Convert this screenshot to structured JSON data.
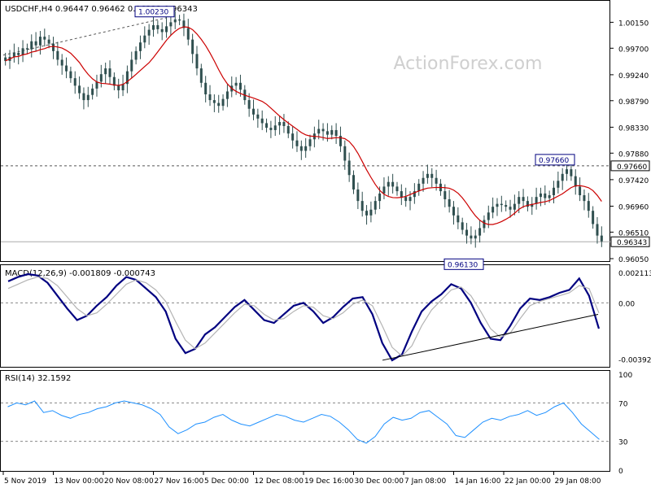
{
  "header": {
    "symbol_info": "USDCHF,H4  0.96447 0.96462 0.96322 0.96343",
    "watermark": "ActionForex.com"
  },
  "colors": {
    "candle": "#2f4f4f",
    "ma": "#cc0000",
    "macd_line": "#000080",
    "macd_signal": "#b4b4b4",
    "rsi": "#1e90ff",
    "level_line": "#555555",
    "frame": "#000000"
  },
  "chart_data": [
    {
      "type": "candlestick",
      "title": "USDCHF,H4  0.96447 0.96462 0.96322 0.96343",
      "ylim": [
        0.9605,
        1.0048
      ],
      "y_ticks": [
        "1.00150",
        "0.99700",
        "0.99240",
        "0.98790",
        "0.98330",
        "0.97880",
        "0.97420",
        "0.96960",
        "0.96510",
        "0.96050"
      ],
      "current_price": "0.96343",
      "levels": [
        {
          "label": "0.97660",
          "value": 0.9766,
          "style": "dashed"
        }
      ],
      "annotations": [
        {
          "label": "1.00230",
          "value": 1.0023
        },
        {
          "label": "0.97660",
          "value": 0.9766
        },
        {
          "label": "0.96130",
          "value": 0.9613
        }
      ],
      "moving_average": "red line",
      "close_series": [
        0.9948,
        0.9955,
        0.9962,
        0.9958,
        0.997,
        0.9968,
        0.9982,
        0.9975,
        0.999,
        0.9985,
        0.9978,
        0.9965,
        0.995,
        0.994,
        0.993,
        0.9918,
        0.9905,
        0.9892,
        0.988,
        0.9889,
        0.99,
        0.9912,
        0.9925,
        0.9935,
        0.992,
        0.9905,
        0.9897,
        0.9908,
        0.993,
        0.995,
        0.9965,
        0.998,
        0.9992,
        1.0002,
        1.001,
        1.0003,
        0.9998,
        1.0008,
        1.0015,
        1.002,
        1.0018,
        1.0005,
        0.9985,
        0.996,
        0.9935,
        0.991,
        0.989,
        0.988,
        0.9875,
        0.987,
        0.9882,
        0.9895,
        0.9905,
        0.991,
        0.9898,
        0.988,
        0.9865,
        0.9855,
        0.9848,
        0.984,
        0.9832,
        0.9828,
        0.9836,
        0.9842,
        0.9835,
        0.9822,
        0.981,
        0.98,
        0.9792,
        0.98,
        0.9812,
        0.9822,
        0.983,
        0.9826,
        0.982,
        0.9828,
        0.9818,
        0.98,
        0.9775,
        0.975,
        0.9725,
        0.9705,
        0.9688,
        0.968,
        0.969,
        0.9705,
        0.9718,
        0.973,
        0.9738,
        0.973,
        0.9722,
        0.9712,
        0.9705,
        0.9712,
        0.9722,
        0.9735,
        0.9745,
        0.9752,
        0.9745,
        0.9735,
        0.9722,
        0.9708,
        0.9695,
        0.968,
        0.9668,
        0.9655,
        0.9645,
        0.964,
        0.9645,
        0.9658,
        0.9672,
        0.9685,
        0.9695,
        0.97,
        0.9698,
        0.9695,
        0.969,
        0.97,
        0.9712,
        0.9705,
        0.9695,
        0.97,
        0.9712,
        0.9718,
        0.971,
        0.9715,
        0.9728,
        0.974,
        0.9752,
        0.976,
        0.9748,
        0.973,
        0.9715,
        0.9705,
        0.9688,
        0.9665,
        0.9645,
        0.9635
      ]
    },
    {
      "type": "line",
      "title": "MACD(12,26,9) -0.001809 -0.000743",
      "ylim": [
        -0.0044,
        0.0024
      ],
      "y_ticks": [
        "0.002113",
        "0.00",
        "-0.003922"
      ],
      "zero_label": "0.00",
      "series": [
        {
          "role": "macd",
          "values": [
            0.0015,
            0.0018,
            0.002,
            0.0019,
            0.0014,
            0.0005,
            -0.0004,
            -0.0012,
            -0.0009,
            -0.0002,
            0.0004,
            0.0012,
            0.0018,
            0.0016,
            0.001,
            0.0004,
            -0.0006,
            -0.0025,
            -0.0035,
            -0.0032,
            -0.0022,
            -0.0017,
            -0.001,
            -0.0003,
            0.0002,
            -0.0005,
            -0.0012,
            -0.0014,
            -0.0008,
            -0.0002,
            0.0,
            -0.0006,
            -0.0014,
            -0.001,
            -0.0003,
            0.0003,
            0.0004,
            -0.0008,
            -0.0028,
            -0.004,
            -0.0036,
            -0.002,
            -0.0006,
            0.0001,
            0.0006,
            0.0013,
            0.001,
            0.0,
            -0.0014,
            -0.0025,
            -0.0026,
            -0.0016,
            -0.0004,
            0.0003,
            0.0002,
            0.0004,
            0.0007,
            0.0009,
            0.0017,
            0.0005,
            -0.0018
          ]
        },
        {
          "role": "signal",
          "values": [
            0.001,
            0.0013,
            0.0016,
            0.0018,
            0.0017,
            0.0012,
            0.0004,
            -0.0004,
            -0.0009,
            -0.0007,
            -0.0001,
            0.0006,
            0.0013,
            0.0016,
            0.0014,
            0.0009,
            0.0001,
            -0.0013,
            -0.0026,
            -0.0032,
            -0.0028,
            -0.0021,
            -0.0014,
            -0.0007,
            -0.0001,
            -0.0002,
            -0.0008,
            -0.0012,
            -0.0011,
            -0.0006,
            -0.0002,
            -0.0003,
            -0.0009,
            -0.0011,
            -0.0007,
            -0.0001,
            0.0002,
            -0.0002,
            -0.0016,
            -0.0031,
            -0.0037,
            -0.003,
            -0.0016,
            -0.0005,
            0.0002,
            0.0009,
            0.0011,
            0.0005,
            -0.0006,
            -0.0018,
            -0.0024,
            -0.0021,
            -0.0011,
            -0.0002,
            0.0001,
            0.0003,
            0.0005,
            0.0007,
            0.0012,
            0.001,
            -0.0007
          ]
        }
      ],
      "trendline": "rising support line from late Dec low to late Jan"
    },
    {
      "type": "line",
      "title": "RSI(14) 32.1592",
      "ylim": [
        0,
        100
      ],
      "y_ticks": [
        "100",
        "70",
        "30",
        "0"
      ],
      "levels": [
        70,
        30
      ],
      "series": [
        {
          "role": "rsi",
          "values": [
            66,
            70,
            68,
            72,
            60,
            62,
            57,
            54,
            58,
            60,
            64,
            66,
            70,
            72,
            70,
            68,
            64,
            58,
            45,
            38,
            42,
            48,
            50,
            55,
            58,
            52,
            48,
            46,
            50,
            54,
            58,
            56,
            52,
            50,
            54,
            58,
            56,
            50,
            42,
            32,
            28,
            35,
            48,
            55,
            52,
            54,
            60,
            62,
            55,
            48,
            36,
            34,
            42,
            50,
            54,
            52,
            56,
            58,
            62,
            57,
            60,
            66,
            70,
            60,
            48,
            40,
            32
          ]
        }
      ]
    }
  ],
  "x_axis": {
    "labels": [
      "5 Nov 2019",
      "13 Nov 00:00",
      "20 Nov 08:00",
      "27 Nov 16:00",
      "5 Dec 00:00",
      "12 Dec 08:00",
      "19 Dec 16:00",
      "30 Dec 00:00",
      "7 Jan 08:00",
      "14 Jan 16:00",
      "22 Jan 00:00",
      "29 Jan 08:00"
    ]
  }
}
